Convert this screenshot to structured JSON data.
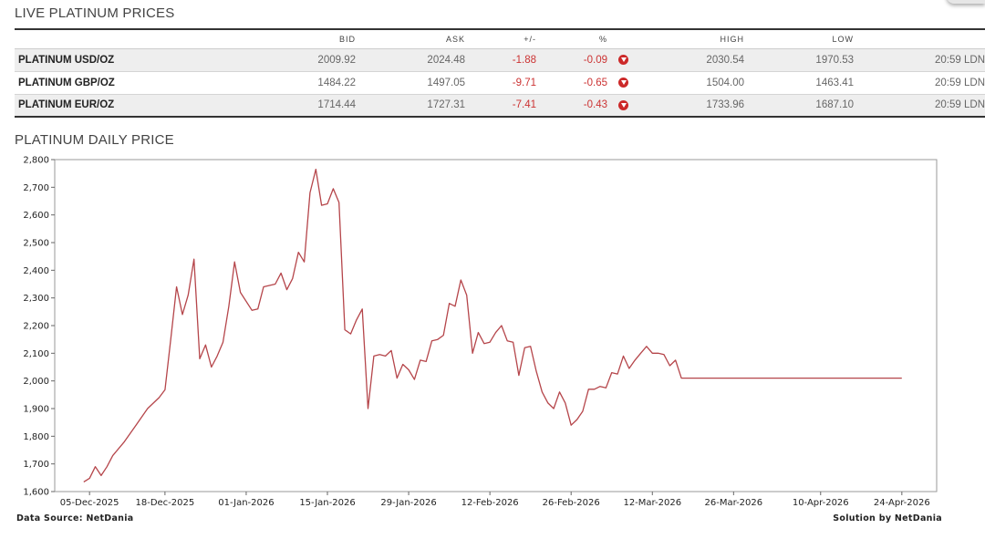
{
  "live_section": {
    "title": "LIVE PLATINUM PRICES",
    "columns": [
      "",
      "BID",
      "ASK",
      "+/-",
      "%",
      "",
      "HIGH",
      "LOW",
      ""
    ],
    "rows": [
      {
        "name": "PLATINUM USD/OZ",
        "bid": "2009.92",
        "ask": "2024.48",
        "change": "-1.88",
        "pct": "-0.09",
        "direction": "down-arrow-icon",
        "high": "2030.54",
        "low": "1970.53",
        "time": "20:59 LDN"
      },
      {
        "name": "PLATINUM GBP/OZ",
        "bid": "1484.22",
        "ask": "1497.05",
        "change": "-9.71",
        "pct": "-0.65",
        "direction": "down-arrow-icon",
        "high": "1504.00",
        "low": "1463.41",
        "time": "20:59 LDN"
      },
      {
        "name": "PLATINUM EUR/OZ",
        "bid": "1714.44",
        "ask": "1727.31",
        "change": "-7.41",
        "pct": "-0.43",
        "direction": "down-arrow-icon",
        "high": "1733.96",
        "low": "1687.10",
        "time": "20:59 LDN"
      }
    ],
    "negative_color": "#cc3333"
  },
  "daily_section": {
    "title": "PLATINUM DAILY PRICE",
    "source_left": "Data Source: NetDania",
    "source_right": "Solution by NetDania"
  },
  "chart_data": {
    "type": "line",
    "title": "",
    "xlabel": "",
    "ylabel": "",
    "ylim": [
      1600,
      2800
    ],
    "yticks": [
      "1,600",
      "1,700",
      "1,800",
      "1,900",
      "2,000",
      "2,100",
      "2,200",
      "2,300",
      "2,400",
      "2,500",
      "2,600",
      "2,700",
      "2,800"
    ],
    "xticks": [
      "05-Dec-2025",
      "18-Dec-2025",
      "01-Jan-2026",
      "15-Jan-2026",
      "29-Jan-2026",
      "12-Feb-2026",
      "26-Feb-2026",
      "12-Mar-2026",
      "26-Mar-2026",
      "10-Apr-2026",
      "24-Apr-2026"
    ],
    "xtick_dates": [
      "2025-12-05",
      "2025-12-18",
      "2026-01-01",
      "2026-01-15",
      "2026-01-29",
      "2026-02-12",
      "2026-02-26",
      "2026-03-12",
      "2026-03-26",
      "2026-04-10",
      "2026-04-24"
    ],
    "grid": false,
    "line_color": "#b5454a",
    "series": [
      {
        "x": [
          "2025-12-04",
          "2025-12-05",
          "2025-12-06",
          "2025-12-07",
          "2025-12-08",
          "2025-12-09",
          "2025-12-11",
          "2025-12-13",
          "2025-12-15",
          "2025-12-17",
          "2025-12-18",
          "2025-12-19",
          "2025-12-20",
          "2025-12-21",
          "2025-12-22",
          "2025-12-23",
          "2025-12-24",
          "2025-12-25",
          "2025-12-26",
          "2025-12-27",
          "2025-12-28",
          "2025-12-29",
          "2025-12-30",
          "2025-12-31",
          "2026-01-02",
          "2026-01-03",
          "2026-01-04",
          "2026-01-05",
          "2026-01-06",
          "2026-01-07",
          "2026-01-08",
          "2026-01-09",
          "2026-01-10",
          "2026-01-11",
          "2026-01-12",
          "2026-01-13",
          "2026-01-14",
          "2026-01-15",
          "2026-01-16",
          "2026-01-17",
          "2026-01-18",
          "2026-01-19",
          "2026-01-20",
          "2026-01-21",
          "2026-01-22",
          "2026-01-23",
          "2026-01-24",
          "2026-01-25",
          "2026-01-26",
          "2026-01-27",
          "2026-01-28",
          "2026-01-29",
          "2026-01-30",
          "2026-01-31",
          "2026-02-01",
          "2026-02-02",
          "2026-02-03",
          "2026-02-04",
          "2026-02-05",
          "2026-02-06",
          "2026-02-07",
          "2026-02-08",
          "2026-02-09",
          "2026-02-10",
          "2026-02-11",
          "2026-02-12",
          "2026-02-13",
          "2026-02-14",
          "2026-02-15",
          "2026-02-16",
          "2026-02-17",
          "2026-02-18",
          "2026-02-19",
          "2026-02-20",
          "2026-02-21",
          "2026-02-22",
          "2026-02-23",
          "2026-02-24",
          "2026-02-25",
          "2026-02-26",
          "2026-02-27",
          "2026-02-28",
          "2026-03-01",
          "2026-03-02",
          "2026-03-03",
          "2026-03-04",
          "2026-03-05",
          "2026-03-06",
          "2026-03-07",
          "2026-03-08",
          "2026-03-09",
          "2026-03-10",
          "2026-03-11",
          "2026-03-12",
          "2026-03-13",
          "2026-03-14",
          "2026-03-15",
          "2026-03-16",
          "2026-03-17",
          "2026-03-18",
          "2026-03-19",
          "2026-03-20",
          "2026-03-21",
          "2026-03-22",
          "2026-03-23",
          "2026-03-24",
          "2026-03-25",
          "2026-03-26",
          "2026-03-27",
          "2026-03-28",
          "2026-03-29",
          "2026-03-30",
          "2026-03-31",
          "2026-04-01",
          "2026-04-02",
          "2026-04-03",
          "2026-04-04",
          "2026-04-05",
          "2026-04-06",
          "2026-04-07",
          "2026-04-08",
          "2026-04-09",
          "2026-04-10",
          "2026-04-11",
          "2026-04-12",
          "2026-04-13",
          "2026-04-14",
          "2026-04-15",
          "2026-04-16",
          "2026-04-17",
          "2026-04-18",
          "2026-04-19",
          "2026-04-20",
          "2026-04-21",
          "2026-04-22",
          "2026-04-23",
          "2026-04-24"
        ],
        "y": [
          1635,
          1648,
          1690,
          1658,
          1690,
          1730,
          1780,
          1840,
          1900,
          1940,
          1968,
          2150,
          2340,
          2240,
          2310,
          2440,
          2080,
          2130,
          2050,
          2090,
          2140,
          2270,
          2430,
          2320,
          2255,
          2260,
          2340,
          2345,
          2350,
          2390,
          2330,
          2370,
          2465,
          2430,
          2680,
          2765,
          2635,
          2640,
          2695,
          2645,
          2185,
          2170,
          2220,
          2260,
          1900,
          2090,
          2095,
          2090,
          2110,
          2010,
          2060,
          2040,
          2005,
          2075,
          2070,
          2145,
          2150,
          2165,
          2280,
          2270,
          2365,
          2310,
          2100,
          2175,
          2135,
          2140,
          2175,
          2200,
          2145,
          2140,
          2020,
          2120,
          2125,
          2035,
          1960,
          1920,
          1900,
          1960,
          1920,
          1840,
          1860,
          1890,
          1970,
          1970,
          1980,
          1975,
          2030,
          2025,
          2090,
          2045,
          2075,
          2100,
          2125,
          2100,
          2100,
          2095,
          2055,
          2075,
          2010,
          2010,
          2010,
          2010,
          2010,
          2010,
          2010,
          2010,
          2010,
          2010,
          2010,
          2010,
          2010,
          2010,
          2010,
          2010,
          2010,
          2010,
          2010,
          2010,
          2010,
          2010,
          2010,
          2010,
          2010,
          2010,
          2010,
          2010,
          2010,
          2010,
          2010,
          2010,
          2010,
          2010,
          2010,
          2010,
          2010,
          2010,
          2010
        ]
      }
    ]
  }
}
